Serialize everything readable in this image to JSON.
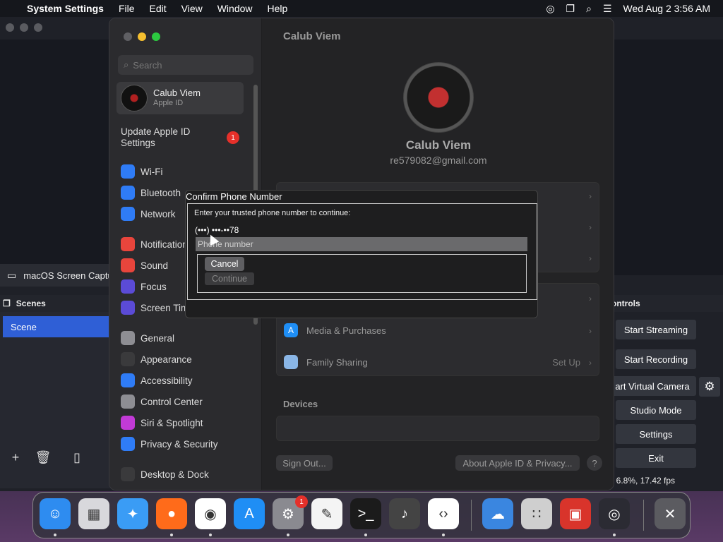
{
  "menubar": {
    "apple_icon": "apple-logo",
    "app_name": "System Settings",
    "menus": [
      "File",
      "Edit",
      "View",
      "Window",
      "Help"
    ],
    "clock": "Wed Aug 2  3:56 AM"
  },
  "obs": {
    "source_name": "macOS Screen Captu",
    "scenes_header": "Scenes",
    "scene_item": "Scene",
    "controls_header": "ontrols",
    "buttons": {
      "start_streaming": "Start Streaming",
      "start_recording": "Start Recording",
      "virtual_camera": "art Virtual Camera",
      "studio_mode": "Studio Mode",
      "settings": "Settings",
      "exit": "Exit"
    },
    "stats": ": 6.8%, 17.42 fps"
  },
  "settings": {
    "search_placeholder": "Search",
    "account": {
      "name": "Calub Viem",
      "subtitle": "Apple ID"
    },
    "update": {
      "label": "Update Apple ID Settings",
      "badge": "1"
    },
    "sidebar_items": [
      {
        "label": "Wi-Fi",
        "icon": "wifi-icon",
        "color": "#2f7cf6"
      },
      {
        "label": "Bluetooth",
        "icon": "bluetooth-icon",
        "color": "#2f7cf6"
      },
      {
        "label": "Network",
        "icon": "globe-icon",
        "color": "#2f7cf6"
      },
      {
        "label": "Notification",
        "icon": "bell-icon",
        "color": "#e8453c"
      },
      {
        "label": "Sound",
        "icon": "speaker-icon",
        "color": "#e8453c"
      },
      {
        "label": "Focus",
        "icon": "moon-icon",
        "color": "#5b4bd6"
      },
      {
        "label": "Screen Tim",
        "icon": "hourglass-icon",
        "color": "#5b4bd6"
      },
      {
        "label": "General",
        "icon": "gear-icon",
        "color": "#8e8e93"
      },
      {
        "label": "Appearance",
        "icon": "appearance-icon",
        "color": "#3a3a3c"
      },
      {
        "label": "Accessibility",
        "icon": "accessibility-icon",
        "color": "#2f7cf6"
      },
      {
        "label": "Control Center",
        "icon": "control-center-icon",
        "color": "#8e8e93"
      },
      {
        "label": "Siri & Spotlight",
        "icon": "siri-icon",
        "color": "#c23ad6"
      },
      {
        "label": "Privacy & Security",
        "icon": "hand-icon",
        "color": "#2f7cf6"
      },
      {
        "label": "Desktop & Dock",
        "icon": "dock-icon",
        "color": "#3a3a3c"
      }
    ],
    "main": {
      "header_name": "Calub Viem",
      "profile_name": "Calub Viem",
      "email": "re579082@gmail.com",
      "media_purchases": "Media & Purchases",
      "family_sharing": "Family Sharing",
      "family_action": "Set Up",
      "devices_header": "Devices",
      "sign_out": "Sign Out...",
      "about": "About Apple ID & Privacy...",
      "help": "?"
    }
  },
  "dialog": {
    "title": "Confirm Phone Number",
    "prompt": "Enter your trusted phone number to continue:",
    "masked_number": "(•••) •••-••78",
    "input_placeholder": "Phone number",
    "cancel": "Cancel",
    "continue": "Continue"
  },
  "dock": {
    "apps": [
      {
        "name": "finder-icon",
        "color": "#2e8cf0",
        "glyph": "☺",
        "running": true
      },
      {
        "name": "launchpad-icon",
        "color": "#d8d8dc",
        "glyph": "▦",
        "running": false
      },
      {
        "name": "safari-icon",
        "color": "#3a9cf5",
        "glyph": "✦",
        "running": false
      },
      {
        "name": "firefox-icon",
        "color": "#ff6b1a",
        "glyph": "●",
        "running": true
      },
      {
        "name": "chrome-icon",
        "color": "#ffffff",
        "glyph": "◉",
        "running": true
      },
      {
        "name": "app-store-icon",
        "color": "#1f8ef5",
        "glyph": "A",
        "running": false
      },
      {
        "name": "system-settings-icon",
        "color": "#8a8a90",
        "glyph": "⚙",
        "running": true,
        "badge": "1"
      },
      {
        "name": "textedit-icon",
        "color": "#f4f4f4",
        "glyph": "✎",
        "running": false
      },
      {
        "name": "terminal-icon",
        "color": "#1b1b1b",
        "glyph": ">_",
        "running": true
      },
      {
        "name": "garageband-icon",
        "color": "#444",
        "glyph": "♪",
        "running": false
      },
      {
        "name": "vscode-icon",
        "color": "#ffffff",
        "glyph": "‹›",
        "running": true
      },
      {
        "name": "weather-icon",
        "color": "#3a86e0",
        "glyph": "☁",
        "running": false
      },
      {
        "name": "calculator-icon",
        "color": "#cfcfcf",
        "glyph": "∷",
        "running": false
      },
      {
        "name": "photo-booth-icon",
        "color": "#d9342b",
        "glyph": "▣",
        "running": false
      },
      {
        "name": "obs-icon",
        "color": "#2b2b33",
        "glyph": "◎",
        "running": true
      },
      {
        "name": "trash-icon",
        "color": "#5b5b60",
        "glyph": "✕",
        "running": false
      }
    ]
  }
}
